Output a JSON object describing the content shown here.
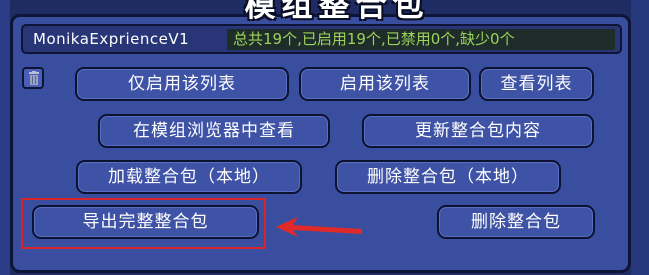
{
  "window": {
    "title": "模组整合包"
  },
  "header": {
    "modpack_name": "MonikaExprienceV1",
    "stats": "总共19个,已启用19个,已禁用0个,缺少0个"
  },
  "buttons": {
    "enable_only": "仅启用该列表",
    "enable_list": "启用该列表",
    "view_list": "查看列表",
    "view_in_browser": "在模组浏览器中查看",
    "update_pack": "更新整合包内容",
    "load_local": "加载整合包（本地）",
    "delete_local": "删除整合包（本地）",
    "export_full": "导出完整整合包",
    "delete_pack": "删除整合包"
  },
  "icons": {
    "trash": "trash-icon",
    "arrow": "arrow-left-icon"
  },
  "colors": {
    "panel": "#3a4ea0",
    "button": "#3f53a6",
    "stats_text": "#9cd35a",
    "highlight": "#d9242a"
  }
}
